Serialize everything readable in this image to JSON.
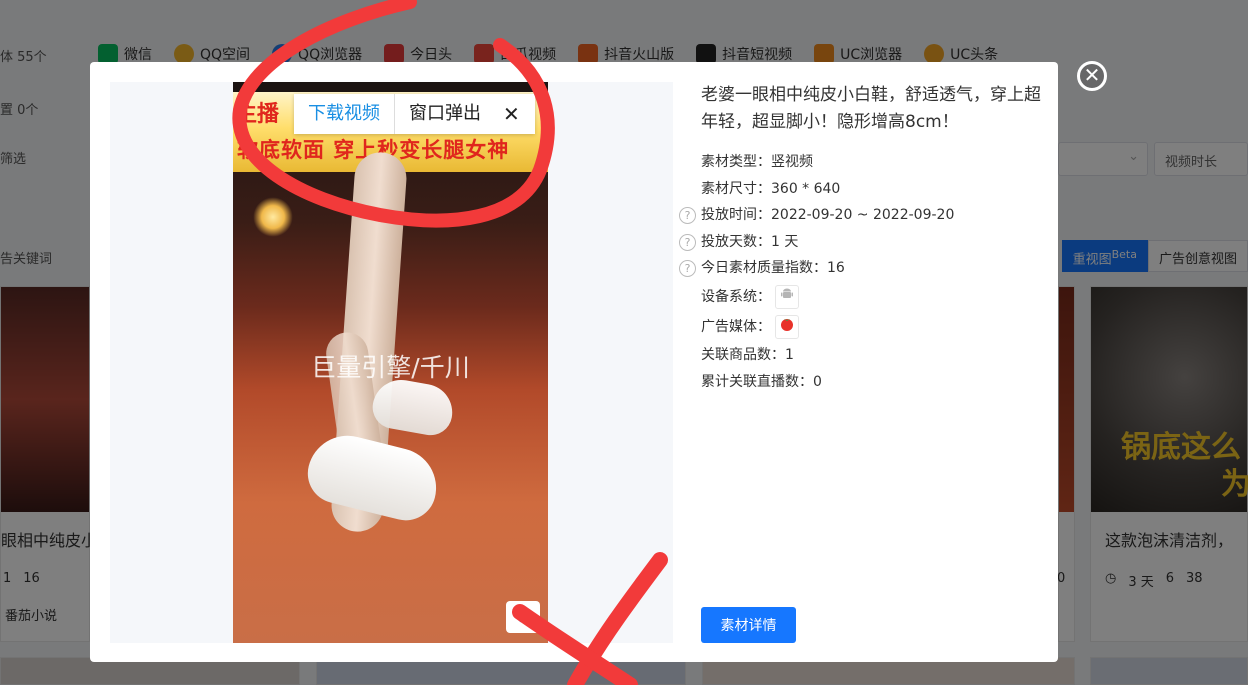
{
  "background": {
    "left_rows": [
      "体 55个",
      "置 0个",
      "筛选",
      "告关键词"
    ],
    "platforms": [
      {
        "label": "微信",
        "icon": "wechat-icon",
        "color": "#07c160"
      },
      {
        "label": "QQ空间",
        "icon": "qzone-icon",
        "color": "#f5b72a"
      },
      {
        "label": "QQ浏览器",
        "icon": "qq-browser-icon",
        "color": "#2b7de9"
      },
      {
        "label": "今日头",
        "icon": "toutiao-icon",
        "color": "#e83a3a"
      },
      {
        "label": "西瓜视频",
        "icon": "xigua-icon",
        "color": "#f2463b"
      },
      {
        "label": "抖音火山版",
        "icon": "huoshan-icon",
        "color": "#f26522"
      },
      {
        "label": "抖音短视频",
        "icon": "douyin-icon",
        "color": "#222222"
      },
      {
        "label": "UC浏览器",
        "icon": "uc-browser-icon",
        "color": "#f08a1c"
      },
      {
        "label": "UC头条",
        "icon": "uc-toutiao-icon",
        "color": "#f3a424"
      }
    ],
    "select_duration": "视频时长",
    "tabs": {
      "heavy": "重视图",
      "beta": "Beta",
      "creative": "广告创意视图"
    },
    "left_card": {
      "title": "眼相中纯皮小",
      "stat1": "1",
      "stat2": "16",
      "source": "番茄小说"
    },
    "right_card": {
      "title": "这款泡沫清洁剂，",
      "overlay": "锅底这么",
      "overlay2": "为",
      "days": "3 天",
      "likes": "6",
      "comments": "38"
    },
    "mid_card_stat": "0"
  },
  "modal": {
    "close_symbol": "✕",
    "download_bar": {
      "download": "下载视频",
      "popup": "窗口弹出",
      "close": "✕"
    },
    "video": {
      "banner_top": "主播",
      "banner_sub": "软底软面 穿上秒变长腿女神",
      "watermark": "巨量引擎/千川",
      "corner": "◐"
    },
    "title": "老婆一眼相中纯皮小白鞋，舒适透气，穿上超年轻，超显脚小！隐形增高8cm！",
    "fields": {
      "type_label": "素材类型：",
      "type_value": "竖视频",
      "size_label": "素材尺寸：",
      "size_value": "360 * 640",
      "time_label": "投放时间：",
      "time_value": "2022-09-20 ~ 2022-09-20",
      "days_label": "投放天数：",
      "days_value": "1 天",
      "quality_label": "今日素材质量指数：",
      "quality_value": "16",
      "device_label": "设备系统：",
      "media_label": "广告媒体：",
      "goods_label": "关联商品数：",
      "goods_value": "1",
      "live_label": "累计关联直播数：",
      "live_value": "0"
    },
    "help_mark": "?",
    "device_icon": "android-icon",
    "media_icon": "fanqie-icon",
    "detail_button": "素材详情"
  }
}
